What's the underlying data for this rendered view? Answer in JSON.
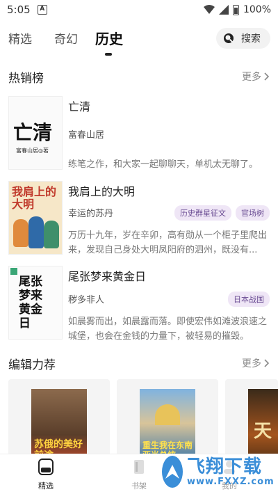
{
  "status_bar": {
    "time": "5:05",
    "notif_badge": "A",
    "battery": "100%"
  },
  "tabs": [
    {
      "label": "精选"
    },
    {
      "label": "奇幻"
    },
    {
      "label": "历史"
    }
  ],
  "active_tab": "历史",
  "search": {
    "label": "搜索"
  },
  "hot": {
    "title": "热销榜",
    "more": "更多",
    "books": [
      {
        "title": "亡清",
        "author": "富春山居",
        "tags": [],
        "desc": "练笔之作，和大家一起聊聊天，单机太无聊了。",
        "cover_text": "亡清",
        "cover_sub": "富春山居◎著"
      },
      {
        "title": "我肩上的大明",
        "author": "幸运的苏丹",
        "tags": [
          "历史群星征文",
          "官场树"
        ],
        "desc": "万历十九年，岁在辛卯，高有勋从一个柜子里爬出来，发现自己身处大明凤阳府的泗州，既没有...",
        "cover_text": "我肩上的大明"
      },
      {
        "title": "尾张梦来黄金日",
        "author": "秽多非人",
        "tags": [
          "日本战国"
        ],
        "desc": "如晨雾而出，如晨露而落。即使宏伟如滩波浪速之城堡，也会在金钱的力量下，被轻易的摧毁。",
        "cover_text": "尾张梦来黄金日"
      }
    ]
  },
  "editor": {
    "title": "编辑力荐",
    "more": "更多",
    "covers": [
      {
        "text": "苏俄的美好前途"
      },
      {
        "text": "重生我在东南亚当总统"
      },
      {
        "text": "天"
      }
    ]
  },
  "bottom_nav": [
    {
      "label": "精选"
    },
    {
      "label": "书架"
    },
    {
      "label": "我的"
    }
  ],
  "watermark": {
    "cn": "飞翔下载",
    "en": "www.FXXZ.com"
  },
  "colors": {
    "tag_bg": "#efe6f6",
    "tag_text": "#6a4c93",
    "watermark": "#3a8ed8"
  }
}
